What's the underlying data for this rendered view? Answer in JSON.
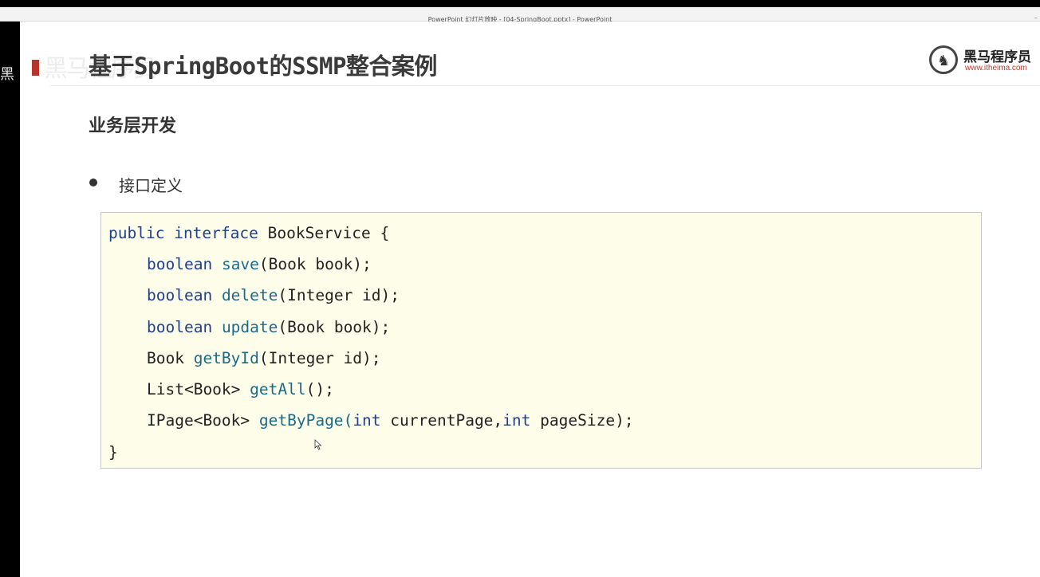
{
  "window": {
    "title": "PowerPoint 幻灯片放映 - [04-SpringBoot.pptx] - PowerPoint",
    "minimize_glyph": "–"
  },
  "left_strip": {
    "text": "黑"
  },
  "slide": {
    "watermark": "黑马程序员",
    "title": "基于SpringBoot的SSMP整合案例",
    "logo": {
      "name": "黑马程序员",
      "url": "www.itheima.com",
      "icon": "horse-logo-icon"
    },
    "section_heading": "业务层开发",
    "bullet": "接口定义",
    "code": {
      "line1": {
        "kw1": "public",
        "kw2": "interface",
        "rest": " BookService {"
      },
      "line2": {
        "type": "boolean",
        "method": "save",
        "rest": "(Book book);"
      },
      "line3": {
        "type": "boolean",
        "method": "delete",
        "rest": "(Integer id);"
      },
      "line4": {
        "type": "boolean",
        "method": "update",
        "rest": "(Book book);"
      },
      "line5": {
        "type": "Book ",
        "method": "getById",
        "rest": "(Integer id);"
      },
      "line6": {
        "type": "List<Book> ",
        "method": "getAll",
        "rest": "();"
      },
      "line7": {
        "type": "IPage<Book> ",
        "method": "getByPage",
        "paren": "(",
        "kw1": "int",
        "mid": " currentPage,",
        "kw2": "int",
        "end": " pageSize);"
      },
      "line8": {
        "text": "}"
      }
    },
    "colors": {
      "keyword": "#1f3f8f",
      "method": "#1b6a8a",
      "code_background": "#fdfde9",
      "accent_red": "#b8342a"
    }
  }
}
